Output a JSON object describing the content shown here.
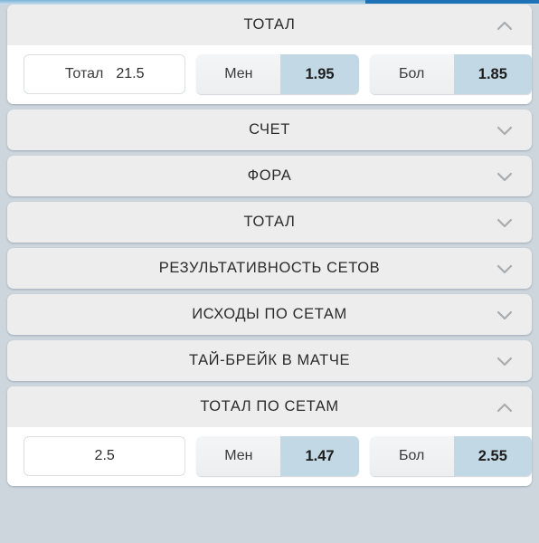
{
  "topbar": {
    "accent_color": "#1d72b8",
    "secondary_color": "#8fbfdd"
  },
  "theme": {
    "page_background": "#cdd6dd",
    "header_background": "#ededed",
    "panel_background": "#ffffff",
    "odds_highlight": "#c3d8e5",
    "chevron_color": "#a9abad",
    "text_color": "#2b2b2b"
  },
  "sections": [
    {
      "id": "total-main",
      "title": "ТОТАЛ",
      "expanded": true,
      "chevron": "chevron-up-icon",
      "markets": [
        {
          "line_label": "Тотал",
          "line_value": "21.5",
          "options": [
            {
              "name": "Мен",
              "price": "1.95"
            },
            {
              "name": "Бол",
              "price": "1.85"
            }
          ]
        }
      ]
    },
    {
      "id": "score",
      "title": "СЧЕТ",
      "expanded": false,
      "chevron": "chevron-down-icon",
      "markets": []
    },
    {
      "id": "handicap",
      "title": "ФОРА",
      "expanded": false,
      "chevron": "chevron-down-icon",
      "markets": []
    },
    {
      "id": "total",
      "title": "ТОТАЛ",
      "expanded": false,
      "chevron": "chevron-down-icon",
      "markets": []
    },
    {
      "id": "set-performance",
      "title": "РЕЗУЛЬТАТИВНОСТЬ СЕТОВ",
      "expanded": false,
      "chevron": "chevron-down-icon",
      "markets": []
    },
    {
      "id": "set-outcomes",
      "title": "ИСХОДЫ ПО СЕТАМ",
      "expanded": false,
      "chevron": "chevron-down-icon",
      "markets": []
    },
    {
      "id": "tiebreak",
      "title": "ТАЙ-БРЕЙК В МАТЧЕ",
      "expanded": false,
      "chevron": "chevron-down-icon",
      "markets": []
    },
    {
      "id": "total-by-sets",
      "title": "ТОТАЛ ПО СЕТАМ",
      "expanded": true,
      "chevron": "chevron-up-icon",
      "markets": [
        {
          "line_label": "",
          "line_value": "2.5",
          "options": [
            {
              "name": "Мен",
              "price": "1.47"
            },
            {
              "name": "Бол",
              "price": "2.55"
            }
          ]
        }
      ]
    }
  ]
}
